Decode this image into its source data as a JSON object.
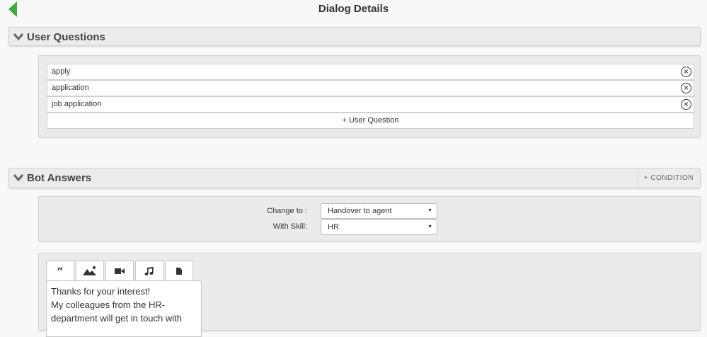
{
  "header": {
    "title": "Dialog Details"
  },
  "user_questions": {
    "title": "User Questions",
    "questions": [
      "apply",
      "application",
      "job application"
    ],
    "add_label": "+ User Question",
    "remove_glyph": "×"
  },
  "bot_answers": {
    "title": "Bot Answers",
    "condition_label": "+ CONDITION",
    "change_to_label": "Change to :",
    "change_to_value": "Handover to agent",
    "skill_label": "With Skill:",
    "skill_value": "HR",
    "tabs": [
      "quote-icon",
      "image-icon",
      "video-icon",
      "music-icon",
      "file-icon"
    ],
    "answer_lines": [
      "Thanks for your interest!",
      "My colleagues from the HR-",
      "department will get in touch with"
    ]
  },
  "colors": {
    "back": "#3cab3c"
  }
}
